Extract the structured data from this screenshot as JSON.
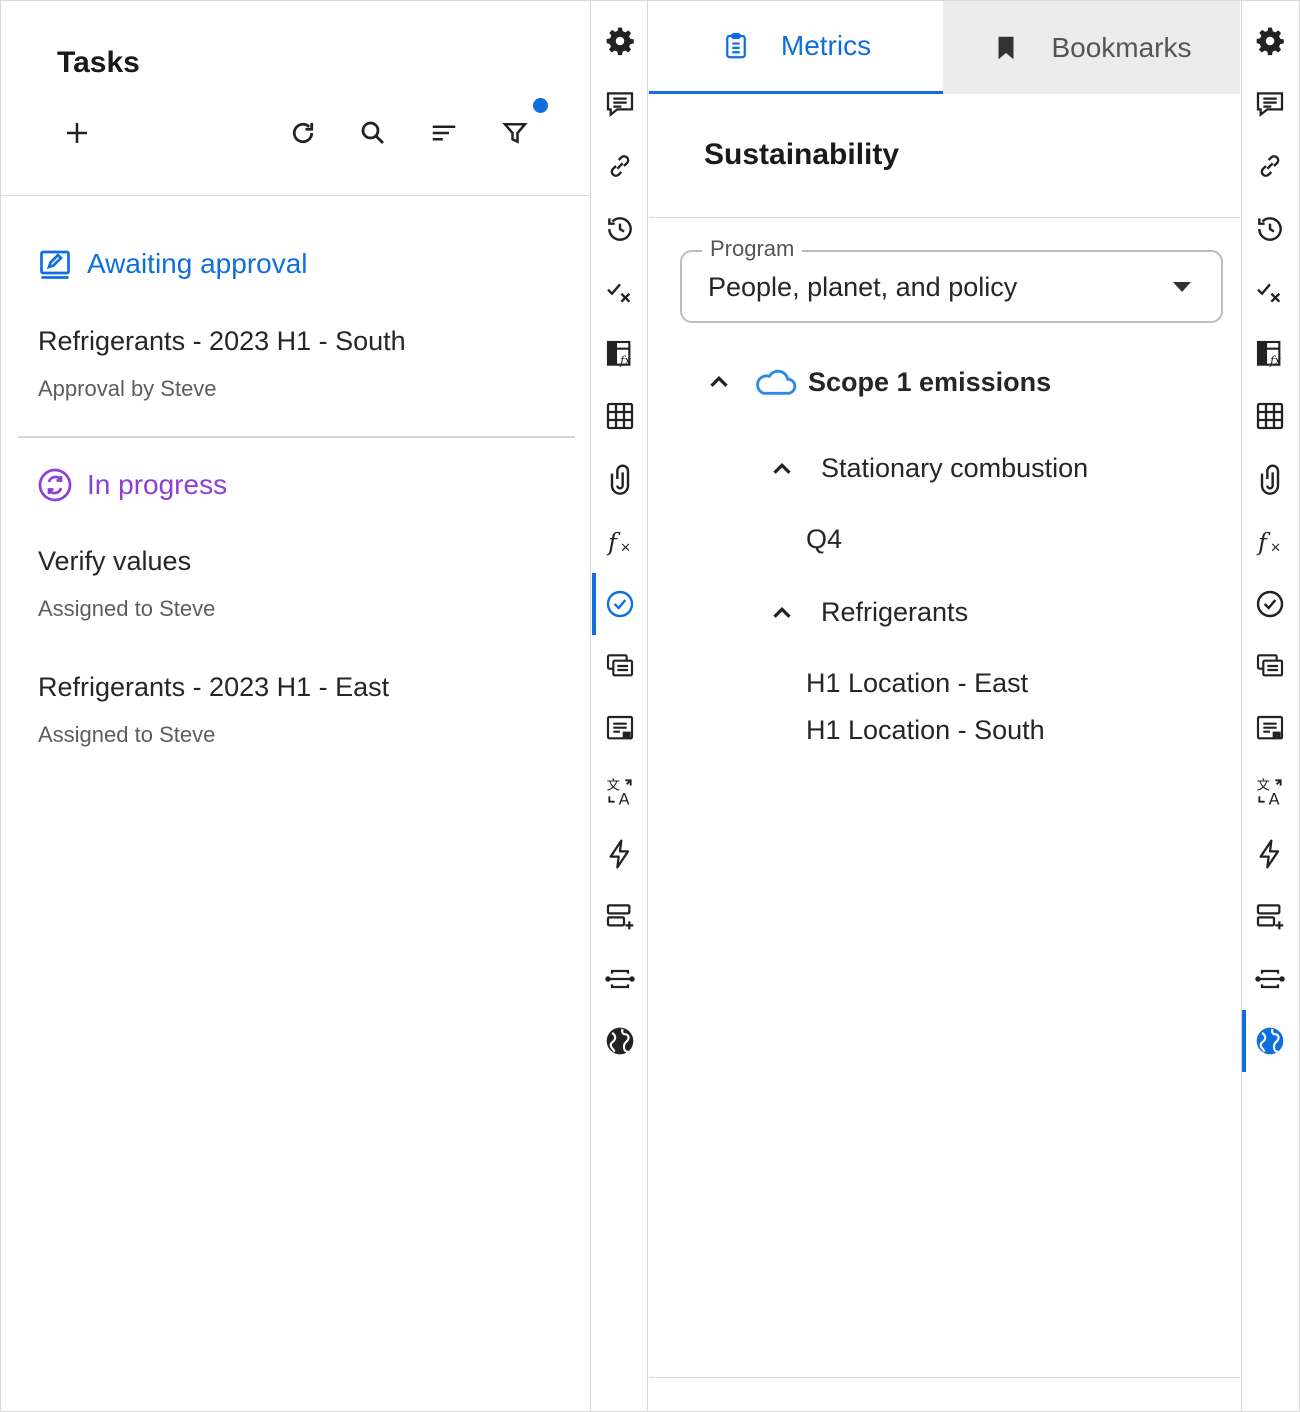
{
  "tasks": {
    "title": "Tasks",
    "sections": [
      {
        "label": "Awaiting approval",
        "color": "#0f6fde",
        "items": [
          {
            "title": "Refrigerants - 2023 H1 - South",
            "subtitle": "Approval by Steve"
          }
        ]
      },
      {
        "label": "In progress",
        "color": "#8f3fd6",
        "items": [
          {
            "title": "Verify values",
            "subtitle": "Assigned to Steve"
          },
          {
            "title": "Refrigerants - 2023 H1 - East",
            "subtitle": "Assigned to Steve"
          }
        ]
      }
    ],
    "toolbar_icons": [
      "add-icon",
      "refresh-icon",
      "search-icon",
      "sort-icon",
      "filter-icon"
    ],
    "filter_active_color": "#0f6fde"
  },
  "rail_left": {
    "icons": [
      "gear-icon",
      "comment-icon",
      "link-icon",
      "history-icon",
      "check-cross-icon",
      "table-formula-icon",
      "table-icon",
      "paperclip-icon",
      "fx-icon",
      "check-circle-icon",
      "cards-icon",
      "note-icon",
      "translate-icon",
      "bolt-icon",
      "list-add-icon",
      "strikethrough-icon",
      "globe-icon"
    ],
    "active": "check-circle-icon"
  },
  "rail_right": {
    "icons": [
      "gear-icon",
      "comment-icon",
      "link-icon",
      "history-icon",
      "check-cross-icon",
      "table-formula-icon",
      "table-icon",
      "paperclip-icon",
      "fx-icon",
      "check-circle-icon",
      "cards-icon",
      "note-icon",
      "translate-icon",
      "bolt-icon",
      "list-add-icon",
      "strikethrough-icon",
      "globe-icon"
    ],
    "active": "globe-icon"
  },
  "metrics": {
    "tabs": [
      {
        "label": "Metrics",
        "icon": "clipboard-icon",
        "active": true
      },
      {
        "label": "Bookmarks",
        "icon": "bookmark-icon",
        "active": false
      }
    ],
    "title": "Sustainability",
    "program": {
      "label": "Program",
      "value": "People, planet, and policy"
    },
    "tree": {
      "label": "Scope 1 emissions",
      "icon": "cloud-icon",
      "children": [
        {
          "label": "Stationary combustion",
          "children": [
            "Q4"
          ]
        },
        {
          "label": "Refrigerants",
          "children": [
            "H1 Location - East",
            "H1 Location - South"
          ]
        }
      ]
    },
    "accent": "#0f6fde"
  }
}
